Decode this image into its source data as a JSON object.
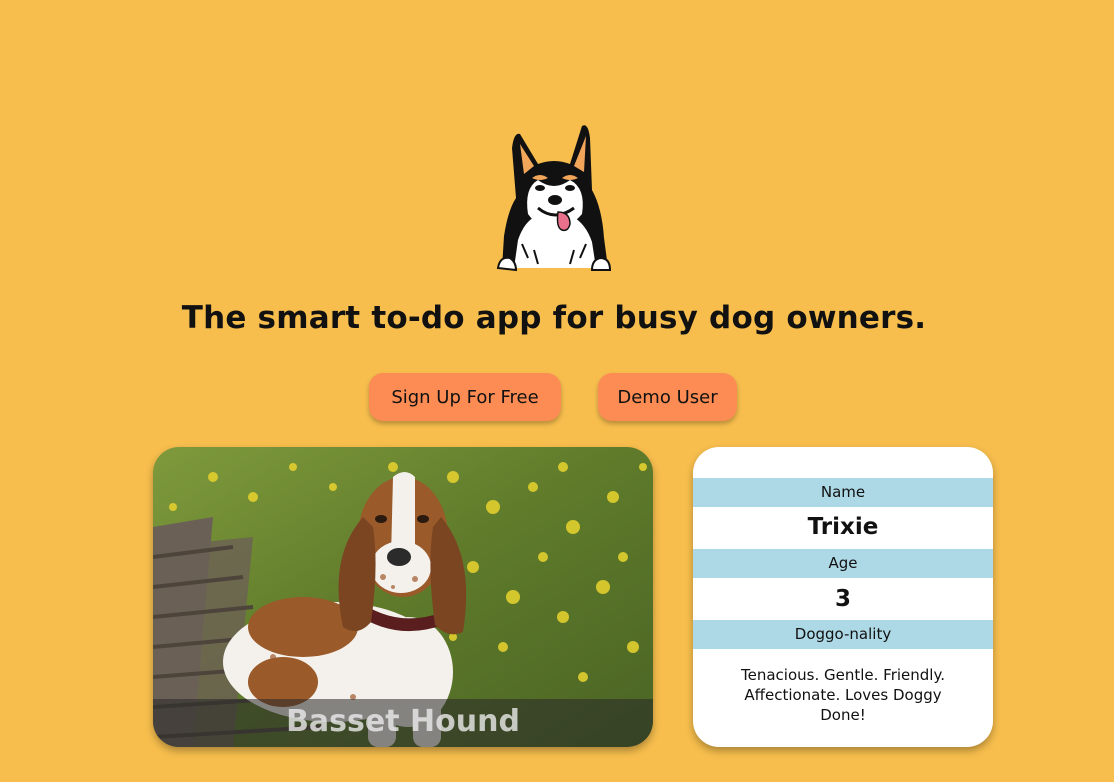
{
  "hero": {
    "logo_icon": "husky-dog-head-icon",
    "headline": "The smart to-do app for busy dog owners."
  },
  "actions": {
    "signup_label": "Sign Up For Free",
    "demo_label": "Demo User"
  },
  "dog_photo": {
    "image_icon": "basset-hound-photo",
    "breed": "Basset Hound"
  },
  "dog_info": {
    "name_label": "Name",
    "name_value": "Trixie",
    "age_label": "Age",
    "age_value": "3",
    "personality_label": "Doggo-nality",
    "personality_value": "Tenacious. Gentle. Friendly. Affectionate. Loves Doggy Done!"
  },
  "colors": {
    "background": "#f7be4d",
    "button": "#fc8c54",
    "label_row": "#add8e6",
    "card": "#ffffff"
  }
}
